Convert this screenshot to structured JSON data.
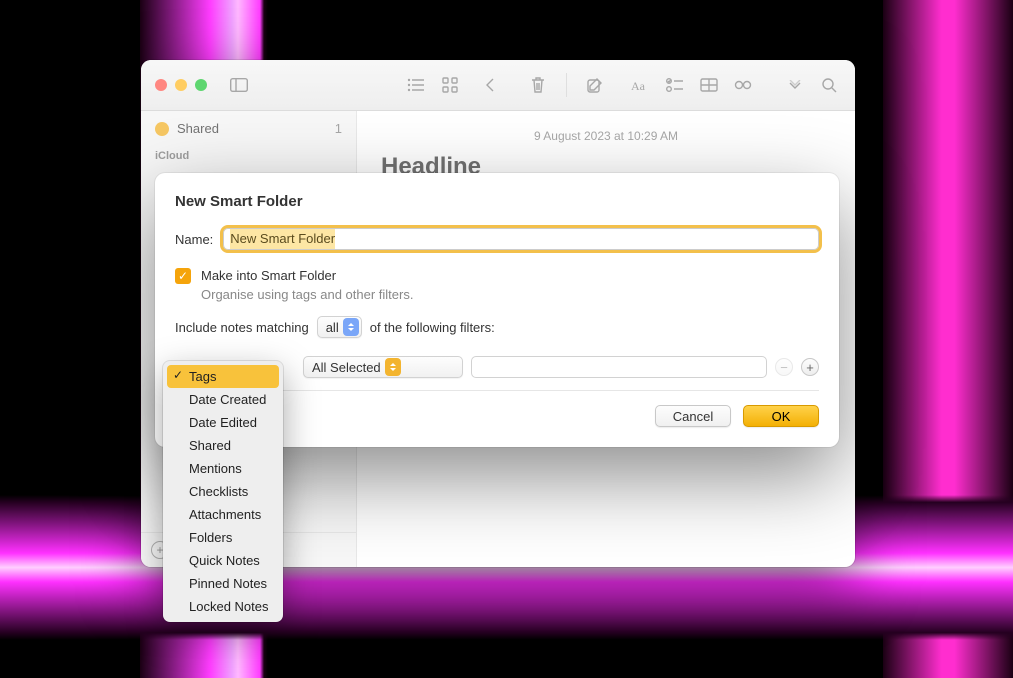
{
  "window": {
    "traffic": {
      "close": "close-window",
      "min": "minimize-window",
      "max": "fullscreen-window"
    }
  },
  "toolbar": {
    "viewList": "list-view",
    "viewGrid": "grid-view",
    "back": "back",
    "delete": "delete",
    "compose": "new-note",
    "format": "format",
    "checklist": "checklist",
    "table": "table",
    "link": "link",
    "more": "more",
    "search": "search"
  },
  "sidebar": {
    "shared": {
      "label": "Shared",
      "count": "1"
    },
    "section_icloud": "iCloud",
    "add": "+"
  },
  "note": {
    "date": "9 August 2023 at 10:29 AM",
    "title": "Headline"
  },
  "modal": {
    "title": "New Smart Folder",
    "name_label": "Name:",
    "name_value": "New Smart Folder",
    "make_smart_label": "Make into Smart Folder",
    "make_smart_desc": "Organise using tags and other filters.",
    "include_pre": "Include notes matching",
    "match_selected": "all",
    "include_post": "of the following filters:",
    "filter_type_label": "Tags",
    "filter_value_label": "All Selected",
    "cancel_label": "Cancel",
    "ok_label": "OK"
  },
  "dropdown": {
    "items": [
      "Tags",
      "Date Created",
      "Date Edited",
      "Shared",
      "Mentions",
      "Checklists",
      "Attachments",
      "Folders",
      "Quick Notes",
      "Pinned Notes",
      "Locked Notes"
    ],
    "selected_index": 0
  }
}
